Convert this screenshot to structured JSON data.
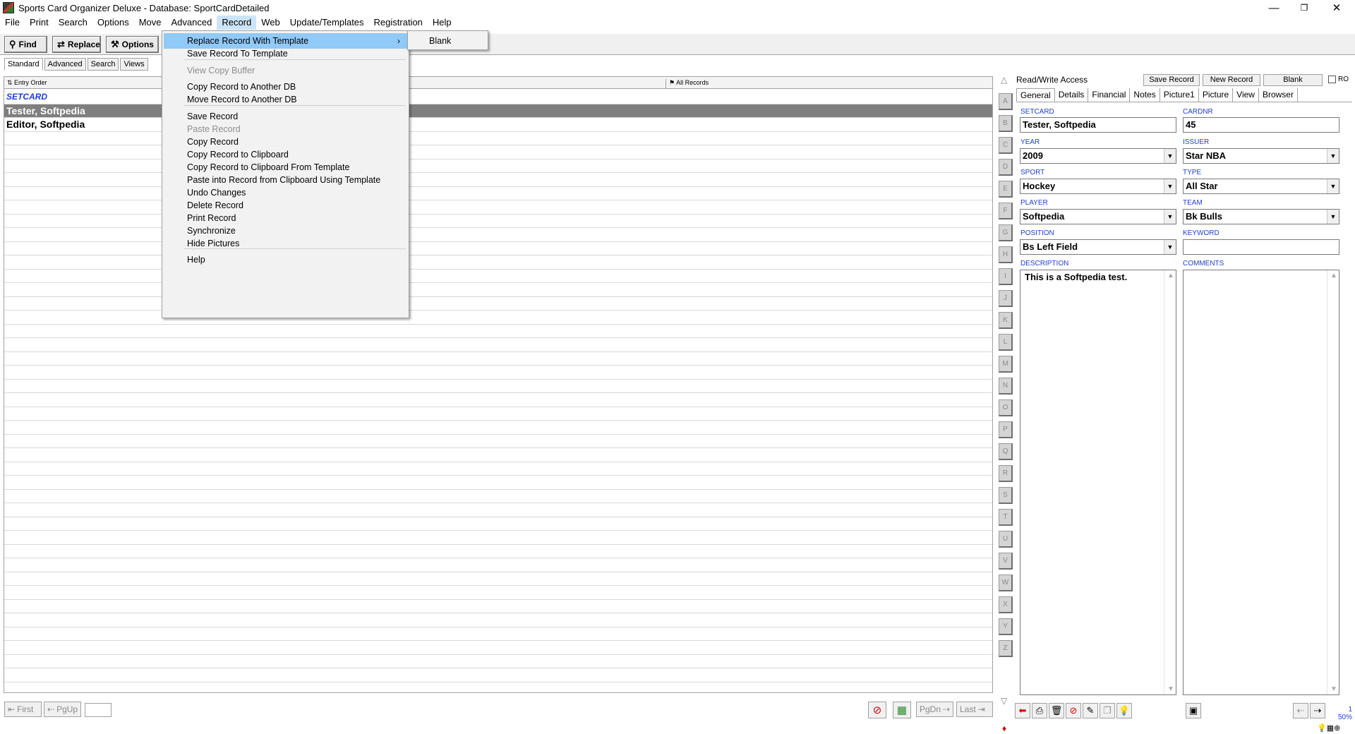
{
  "window": {
    "title": "Sports Card Organizer Deluxe - Database: SportCardDetailed",
    "minimize": "—",
    "maximize": "❐",
    "close": "✕"
  },
  "menubar": [
    "File",
    "Print",
    "Search",
    "Options",
    "Move",
    "Advanced",
    "Record",
    "Web",
    "Update/Templates",
    "Registration",
    "Help"
  ],
  "toolbar": {
    "find": "Find",
    "replace": "Replace",
    "options": "Options",
    "tabs": [
      "Standard",
      "Advanced",
      "Search",
      "Views"
    ]
  },
  "list": {
    "sort_label": "Entry Order",
    "filter_label": "All Records",
    "column_header": "SETCARD",
    "rows": [
      "Tester, Softpedia",
      "Editor, Softpedia"
    ],
    "selected_index": 0
  },
  "alphabet": [
    "A",
    "B",
    "C",
    "D",
    "E",
    "F",
    "G",
    "H",
    "I",
    "J",
    "K",
    "L",
    "M",
    "N",
    "O",
    "P",
    "Q",
    "R",
    "S",
    "T",
    "U",
    "V",
    "W",
    "X",
    "Y",
    "Z"
  ],
  "nav": {
    "first": "First",
    "pgup": "PgUp",
    "pgdn": "PgDn",
    "last": "Last"
  },
  "record": {
    "access": "Read/Write Access",
    "save": "Save Record",
    "new": "New Record",
    "blank": "Blank",
    "ro": "RO",
    "tabs": [
      "General",
      "Details",
      "Financial",
      "Notes",
      "Picture1",
      "Picture",
      "View",
      "Browser"
    ],
    "fields": {
      "setcard": {
        "label": "SETCARD",
        "value": "Tester, Softpedia"
      },
      "cardnr": {
        "label": "CARDNR",
        "value": "45"
      },
      "year": {
        "label": "YEAR",
        "value": "2009"
      },
      "issuer": {
        "label": "ISSUER",
        "value": "Star NBA"
      },
      "sport": {
        "label": "SPORT",
        "value": "Hockey"
      },
      "type": {
        "label": "TYPE",
        "value": "All Star"
      },
      "player": {
        "label": "PLAYER",
        "value": "Softpedia"
      },
      "team": {
        "label": "TEAM",
        "value": "Bk Bulls"
      },
      "position": {
        "label": "POSITION",
        "value": "Bs Left Field"
      },
      "keyword": {
        "label": "KEYWORD",
        "value": ""
      },
      "description": {
        "label": "DESCRIPTION",
        "value": "This is a Softpedia test."
      },
      "comments": {
        "label": "COMMENTS",
        "value": ""
      }
    },
    "zoom": "1\n50%"
  },
  "record_menu": {
    "items": [
      {
        "label": "Replace Record With Template",
        "submenu": "›",
        "highlighted": true
      },
      {
        "label": "Save Record To Template"
      },
      {
        "label": "View Copy Buffer",
        "disabled": true
      },
      {
        "label": "Copy Record to Another DB"
      },
      {
        "label": "Move Record to Another DB"
      },
      {
        "label": "Save Record"
      },
      {
        "label": "Paste Record",
        "disabled": true
      },
      {
        "label": "Copy Record"
      },
      {
        "label": "Copy Record to Clipboard"
      },
      {
        "label": "Copy Record to Clipboard From Template"
      },
      {
        "label": "Paste into Record from Clipboard Using Template"
      },
      {
        "label": "Undo Changes"
      },
      {
        "label": "Delete Record"
      },
      {
        "label": "Print Record"
      },
      {
        "label": "Synchronize"
      },
      {
        "label": "Hide Pictures"
      },
      {
        "label": "Help"
      }
    ],
    "submenu_items": [
      "Blank"
    ]
  }
}
